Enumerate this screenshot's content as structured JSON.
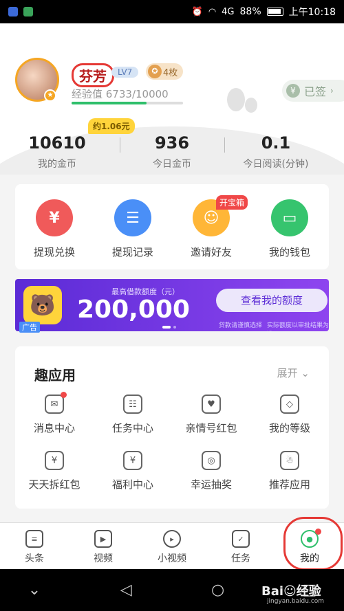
{
  "status_bar": {
    "signal": "4G",
    "battery": "88%",
    "time": "上午10:18"
  },
  "profile": {
    "username": "芬芳",
    "level": "LV7",
    "medal_count": "4枚",
    "exp_label": "经验值 6733/10000",
    "exp_progress": 0.6733,
    "signed_label": "已签"
  },
  "stats": {
    "bubble": "约1.06元",
    "items": [
      {
        "value": "10610",
        "label": "我的金币"
      },
      {
        "value": "936",
        "label": "今日金币"
      },
      {
        "value": "0.1",
        "label": "今日阅读(分钟)"
      }
    ]
  },
  "quick_actions": [
    {
      "label": "提现兑换",
      "icon": "yen-icon",
      "color": "#f05a5a"
    },
    {
      "label": "提现记录",
      "icon": "record-icon",
      "color": "#4a8ff7"
    },
    {
      "label": "邀请好友",
      "icon": "friend-icon",
      "color": "#ffb637",
      "badge": "开宝箱"
    },
    {
      "label": "我的钱包",
      "icon": "wallet-icon",
      "color": "#36c46e"
    }
  ],
  "ad": {
    "caption": "最高借款额度（元）",
    "amount": "200,000",
    "button": "查看我的额度",
    "sub1": "贷款请谨慎选择",
    "sub2": "实际额度以审批结果为准",
    "tag": "广告"
  },
  "apps": {
    "title": "趣应用",
    "expand": "展开",
    "items": [
      {
        "label": "消息中心",
        "icon": "message-icon"
      },
      {
        "label": "任务中心",
        "icon": "task-list-icon"
      },
      {
        "label": "亲情号红包",
        "icon": "red-packet-heart-icon"
      },
      {
        "label": "我的等级",
        "icon": "diamond-icon"
      },
      {
        "label": "天天拆红包",
        "icon": "red-packet-icon"
      },
      {
        "label": "福利中心",
        "icon": "welfare-icon"
      },
      {
        "label": "幸运抽奖",
        "icon": "lottery-icon"
      },
      {
        "label": "推荐应用",
        "icon": "robot-icon"
      }
    ]
  },
  "tabs": [
    {
      "label": "头条",
      "icon": "news-icon"
    },
    {
      "label": "视频",
      "icon": "video-icon"
    },
    {
      "label": "小视频",
      "icon": "short-video-icon"
    },
    {
      "label": "任务",
      "icon": "task-icon"
    },
    {
      "label": "我的",
      "icon": "profile-icon"
    }
  ],
  "colors": {
    "brand_green": "#2fbf6b",
    "accent_red": "#f04848"
  }
}
